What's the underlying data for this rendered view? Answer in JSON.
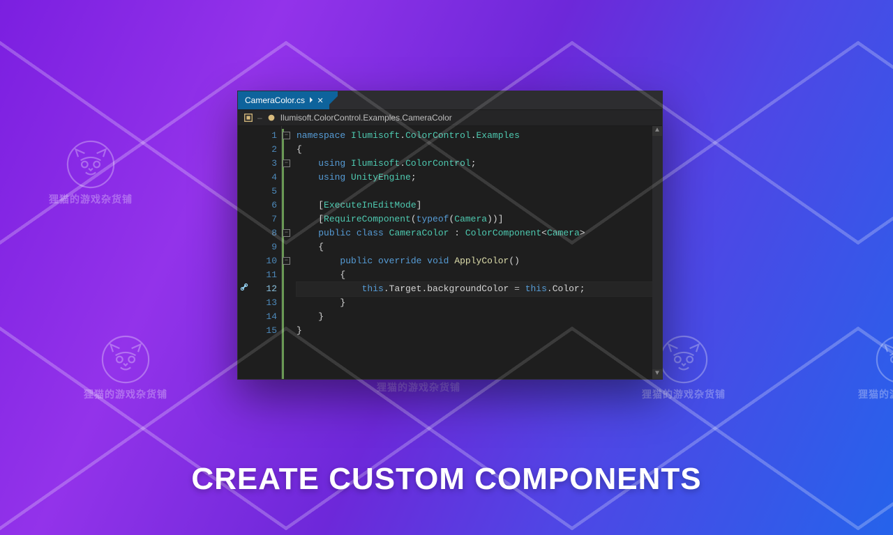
{
  "headline": "CREATE CUSTOM COMPONENTS",
  "watermark_caption": "狸猫的游戏杂货铺",
  "tab": {
    "filename": "CameraColor.cs"
  },
  "navbar": {
    "namespace_path": "Ilumisoft.ColorControl.Examples.CameraColor"
  },
  "line_numbers": [
    "1",
    "2",
    "3",
    "4",
    "5",
    "6",
    "7",
    "8",
    "9",
    "10",
    "11",
    "12",
    "13",
    "14",
    "15"
  ],
  "highlighted_line": 12,
  "code_tokens": {
    "l1": [
      [
        "kw",
        "namespace"
      ],
      [
        "pun",
        " "
      ],
      [
        "type",
        "Ilumisoft"
      ],
      [
        "pun",
        "."
      ],
      [
        "type",
        "ColorControl"
      ],
      [
        "pun",
        "."
      ],
      [
        "type",
        "Examples"
      ]
    ],
    "l2": [
      [
        "pun",
        "{"
      ]
    ],
    "l3": [
      [
        "pun",
        "    "
      ],
      [
        "kw",
        "using"
      ],
      [
        "pun",
        " "
      ],
      [
        "type",
        "Ilumisoft"
      ],
      [
        "pun",
        "."
      ],
      [
        "type",
        "ColorControl"
      ],
      [
        "pun",
        ";"
      ]
    ],
    "l4": [
      [
        "pun",
        "    "
      ],
      [
        "kw",
        "using"
      ],
      [
        "pun",
        " "
      ],
      [
        "type",
        "UnityEngine"
      ],
      [
        "pun",
        ";"
      ]
    ],
    "l5": [
      [
        "pun",
        " "
      ]
    ],
    "l6": [
      [
        "pun",
        "    ["
      ],
      [
        "type",
        "ExecuteInEditMode"
      ],
      [
        "pun",
        "]"
      ]
    ],
    "l7": [
      [
        "pun",
        "    ["
      ],
      [
        "type",
        "RequireComponent"
      ],
      [
        "pun",
        "("
      ],
      [
        "kw",
        "typeof"
      ],
      [
        "pun",
        "("
      ],
      [
        "type",
        "Camera"
      ],
      [
        "pun",
        "))]"
      ]
    ],
    "l8": [
      [
        "pun",
        "    "
      ],
      [
        "kw",
        "public"
      ],
      [
        "pun",
        " "
      ],
      [
        "kw",
        "class"
      ],
      [
        "pun",
        " "
      ],
      [
        "type",
        "CameraColor"
      ],
      [
        "pun",
        " : "
      ],
      [
        "type",
        "ColorComponent"
      ],
      [
        "pun",
        "<"
      ],
      [
        "type",
        "Camera"
      ],
      [
        "pun",
        ">"
      ]
    ],
    "l9": [
      [
        "pun",
        "    {"
      ]
    ],
    "l10": [
      [
        "pun",
        "        "
      ],
      [
        "kw",
        "public"
      ],
      [
        "pun",
        " "
      ],
      [
        "kw",
        "override"
      ],
      [
        "pun",
        " "
      ],
      [
        "kw",
        "void"
      ],
      [
        "pun",
        " "
      ],
      [
        "fn",
        "ApplyColor"
      ],
      [
        "pun",
        "()"
      ]
    ],
    "l11": [
      [
        "pun",
        "        {"
      ]
    ],
    "l12": [
      [
        "pun",
        "            "
      ],
      [
        "kw",
        "this"
      ],
      [
        "pun",
        ".Target.backgroundColor "
      ],
      [
        "op",
        "="
      ],
      [
        "pun",
        " "
      ],
      [
        "kw",
        "this"
      ],
      [
        "pun",
        ".Color;"
      ]
    ],
    "l13": [
      [
        "pun",
        "        }"
      ]
    ],
    "l14": [
      [
        "pun",
        "    }"
      ]
    ],
    "l15": [
      [
        "pun",
        "}"
      ]
    ]
  },
  "fold_markers": [
    1,
    3,
    8,
    10
  ]
}
